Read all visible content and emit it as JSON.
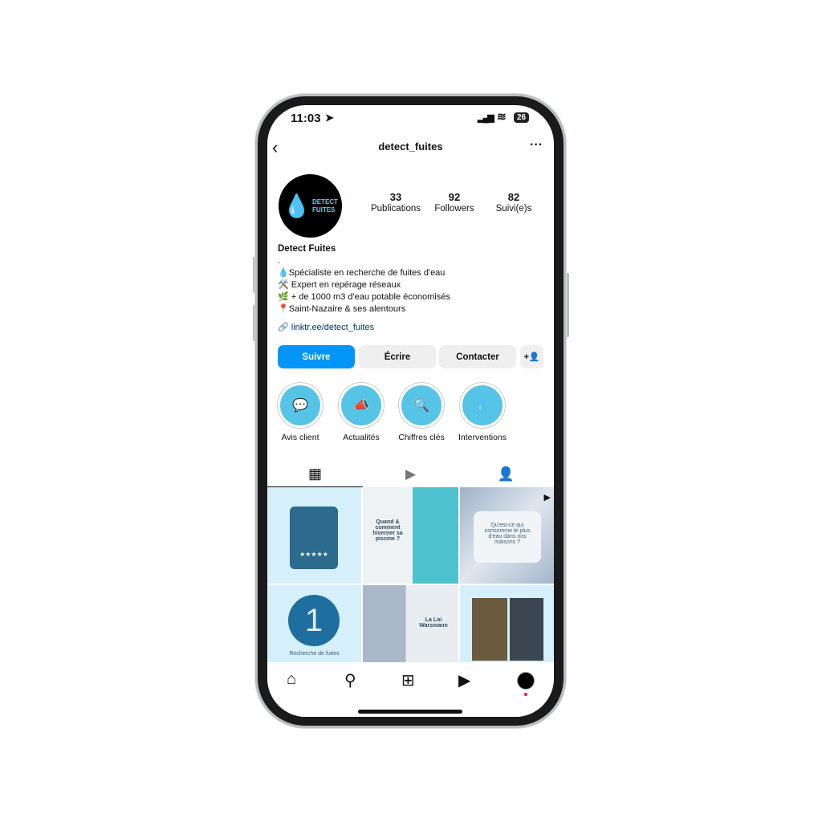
{
  "status": {
    "time": "11:03",
    "battery": "26"
  },
  "header": {
    "username": "detect_fuites",
    "back_icon": "chevron-left-icon",
    "more_icon": "ellipsis-icon"
  },
  "profile": {
    "avatar_text": [
      "DETECT",
      "FUITES"
    ],
    "stats": [
      {
        "value": "33",
        "label": "Publications"
      },
      {
        "value": "92",
        "label": "Followers"
      },
      {
        "value": "82",
        "label": "Suivi(e)s"
      }
    ],
    "name": "Detect Fuites",
    "bio": [
      ".",
      "💧Spécialiste en recherche de fuites d'eau",
      "🛠️ Expert en repérage réseaux",
      "🌿 + de 1000 m3 d'eau potable économisés",
      "📍Saint-Nazaire & ses alentours"
    ],
    "link": "linktr.ee/detect_fuites"
  },
  "buttons": {
    "follow": "Suivre",
    "message": "Écrire",
    "contact": "Contacter"
  },
  "colors": {
    "accent": "#0095f6",
    "highlight": "#55c4e6"
  },
  "highlights": [
    {
      "label": "Avis client",
      "icon": "chat-icon"
    },
    {
      "label": "Actualités",
      "icon": "megaphone-icon"
    },
    {
      "label": "Chiffres clés",
      "icon": "magnifier-icon"
    },
    {
      "label": "Interventions",
      "icon": "drops-icon"
    }
  ],
  "posts": {
    "p2": "Quand & comment hiverner sa piscine ?",
    "p3": "Qu'est-ce qui consomme le plus d'eau dans nos maisons ?",
    "p4": "Recherche de fuites",
    "p5": "La Loi Warsmann",
    "p4_num": "1"
  }
}
